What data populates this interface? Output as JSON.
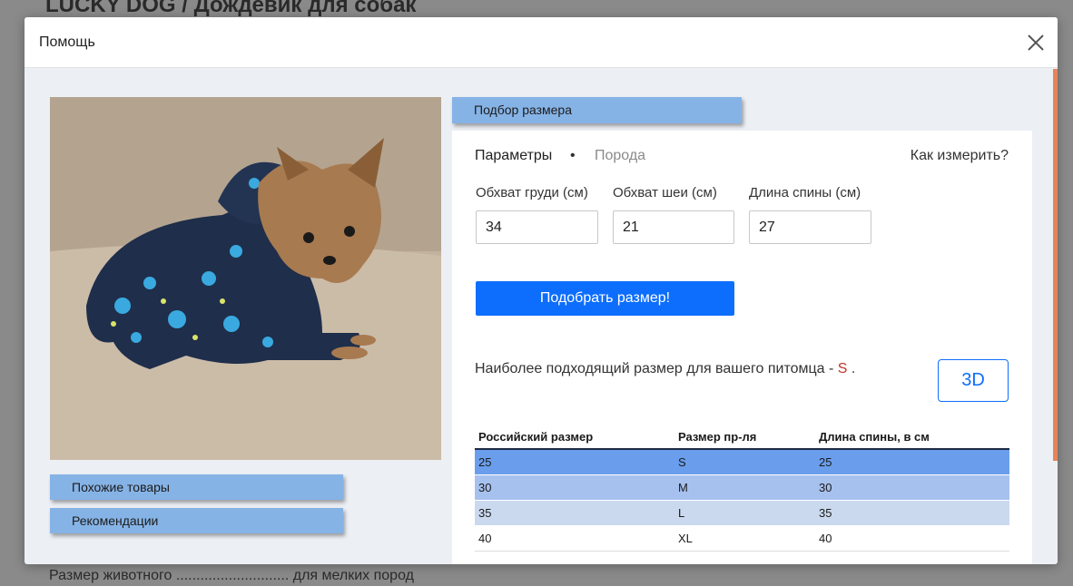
{
  "background": {
    "title": "LUCKY DOG / Дождевик для собак",
    "footer": "Размер животного ............................ для мелких пород"
  },
  "modal": {
    "title": "Помощь",
    "close_icon": "close-icon"
  },
  "sidebar": {
    "similar_label": "Похожие товары",
    "recommendations_label": "Рекомендации"
  },
  "size_picker": {
    "header_label": "Подбор размера",
    "tabs": {
      "params": "Параметры",
      "separator": "•",
      "breed": "Порода"
    },
    "how_to_measure": "Как измерить?",
    "fields": [
      {
        "label": "Обхват груди (см)",
        "value": "34"
      },
      {
        "label": "Обхват шеи (см)",
        "value": "21"
      },
      {
        "label": "Длина спины (см)",
        "value": "27"
      }
    ],
    "submit_label": "Подобрать размер!",
    "result_prefix": "Наиболее подходящий размер для вашего питомца -",
    "result_size": "S",
    "result_suffix": ".",
    "btn_3d": "3D"
  },
  "size_table": {
    "headers": [
      "Российский размер",
      "Размер пр-ля",
      "Длина спины, в см"
    ],
    "rows": [
      [
        "25",
        "S",
        "25"
      ],
      [
        "30",
        "M",
        "30"
      ],
      [
        "35",
        "L",
        "35"
      ],
      [
        "40",
        "XL",
        "40"
      ]
    ]
  },
  "colors": {
    "accent": "#0d6efd",
    "tab_blue": "#86b3e6",
    "scroll_thumb": "#e8825a",
    "result_highlight": "#c0392b"
  }
}
